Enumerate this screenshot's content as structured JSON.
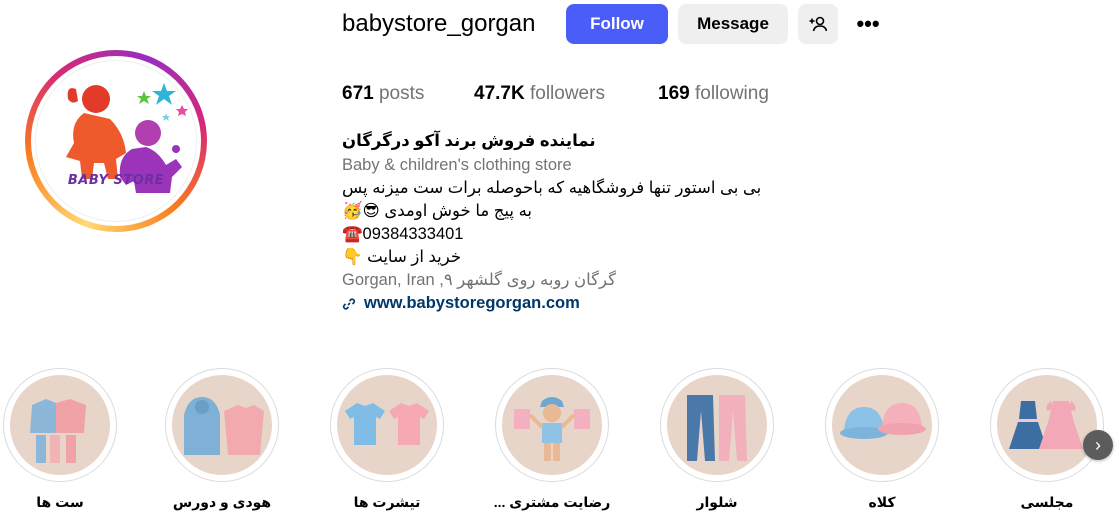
{
  "profile": {
    "username": "babystore_gorgan",
    "logo_text": "BABY STORE",
    "follow_label": "Follow",
    "message_label": "Message",
    "more_label": "•••",
    "stats": {
      "posts_count": "671",
      "posts_label": "posts",
      "followers_count": "47.7K",
      "followers_label": "followers",
      "following_count": "169",
      "following_label": "following"
    },
    "bio": {
      "name": "نماینده فروش برند آکو درگرگان",
      "category": "Baby & children's clothing store",
      "line1": "بی بی استور تنها فروشگاهیه که باحوصله برات ست میزنه پس",
      "line2": "به پیج ما خوش اومدی 😎🥳",
      "phone": "☎️09384333401",
      "line4": "خرید از سایت 👇",
      "location": "Gorgan, Iran ,گرگان روبه روی گلشهر ۹",
      "website": "www.babystoregorgan.com"
    }
  },
  "highlights": [
    {
      "label": "ست ها",
      "icon": "sweatsuit"
    },
    {
      "label": "هودی و دورس",
      "icon": "hoodie"
    },
    {
      "label": "تیشرت ها",
      "icon": "tshirt"
    },
    {
      "label": "رضایت مشتری ...",
      "icon": "child"
    },
    {
      "label": "شلوار",
      "icon": "pants"
    },
    {
      "label": "کلاه",
      "icon": "bucket-hat"
    },
    {
      "label": "مجلسی",
      "icon": "dress"
    }
  ],
  "colors": {
    "follow_button": "#4a5df9",
    "secondary_button": "#efefef",
    "link": "#00376b",
    "muted_text": "#737373"
  }
}
